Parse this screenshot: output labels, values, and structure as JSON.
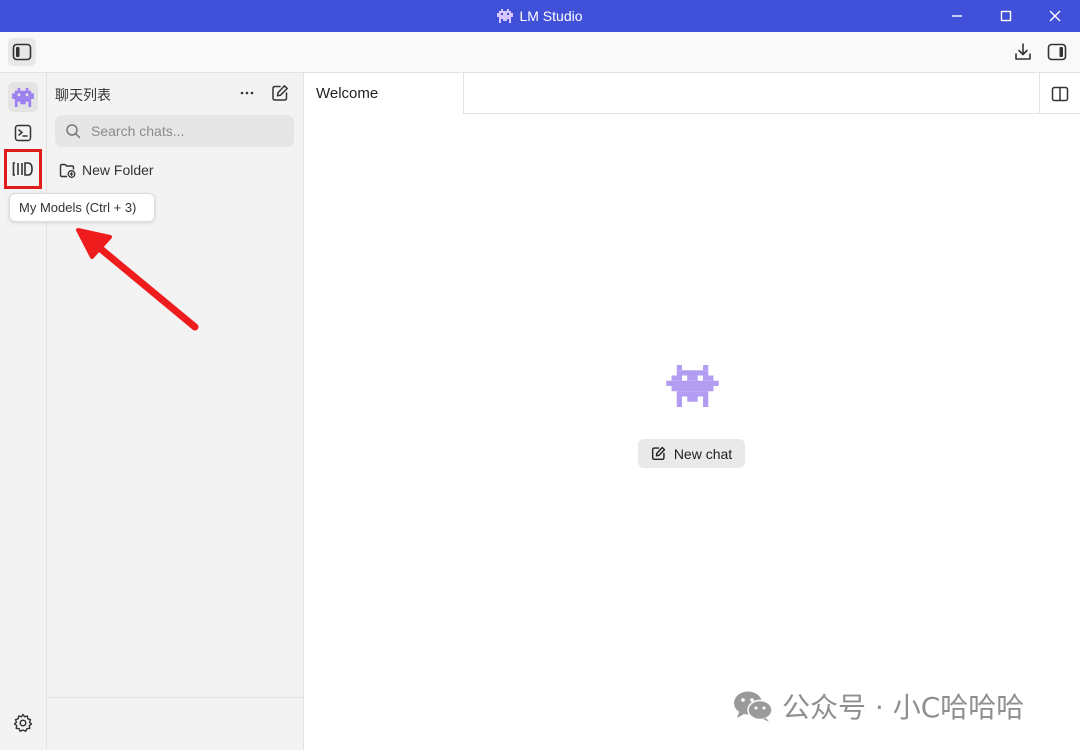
{
  "window": {
    "title": "LM Studio",
    "accent_color": "#4150d9"
  },
  "toolbar": {
    "left_icon": "sidebar-toggle-icon",
    "right_icons": [
      "download-icon",
      "right-panel-icon"
    ]
  },
  "rail": {
    "items": [
      {
        "icon": "lmstudio-logo-icon",
        "label": "Chat"
      },
      {
        "icon": "terminal-icon",
        "label": "Developer"
      },
      {
        "icon": "models-icon",
        "label": "My Models"
      }
    ],
    "settings_icon": "gear-icon"
  },
  "chat_panel": {
    "title": "聊天列表",
    "search_placeholder": "Search chats...",
    "new_folder_label": "New Folder"
  },
  "tooltip": {
    "text": "My Models (Ctrl + 3)"
  },
  "main": {
    "tab_label": "Welcome",
    "new_chat_label": "New chat",
    "logo_color": "#b39df2"
  },
  "annotation": {
    "highlight_color": "#e01b1b"
  },
  "watermark": {
    "text": "公众号 · 小C哈哈哈"
  }
}
